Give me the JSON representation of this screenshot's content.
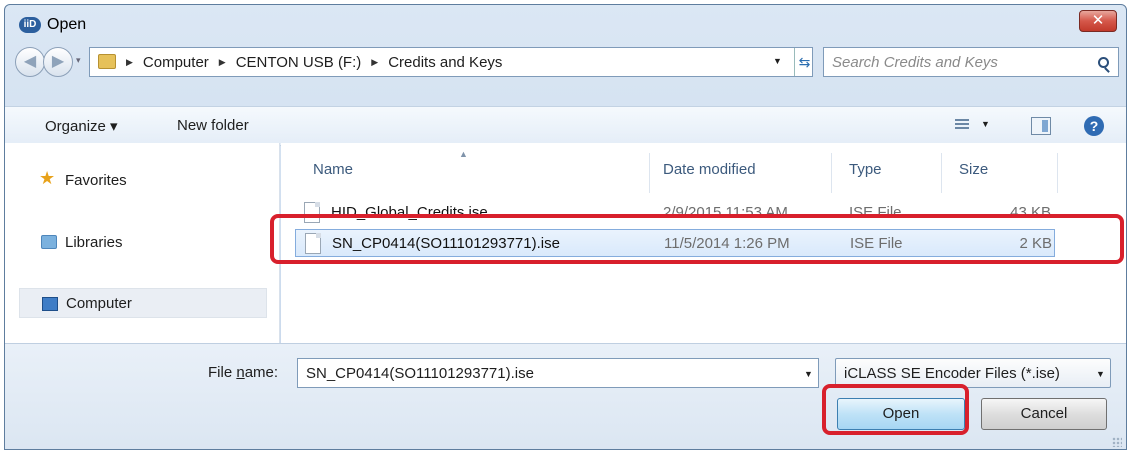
{
  "window": {
    "title": "Open",
    "app_icon": "hid-logo-icon",
    "app_icon_text": "iiD",
    "close_glyph": "✕"
  },
  "nav": {
    "back_glyph": "◀",
    "forward_glyph": "▶",
    "breadcrumbs": [
      "Computer",
      "CENTON USB (F:)",
      "Credits and Keys"
    ],
    "separator": "▶",
    "search_placeholder": "Search Credits and Keys"
  },
  "toolbar": {
    "organize_label": "Organize ▾",
    "new_folder_label": "New folder",
    "help_glyph": "?"
  },
  "sidebar": {
    "items": [
      {
        "label": "Favorites",
        "icon": "star-icon"
      },
      {
        "label": "Libraries",
        "icon": "libraries-icon"
      },
      {
        "label": "Computer",
        "icon": "computer-icon"
      }
    ]
  },
  "file_list": {
    "columns": [
      "Name",
      "Date modified",
      "Type",
      "Size"
    ],
    "rows": [
      {
        "name": "HID_Global_Credits.ise",
        "date": "2/9/2015 11:53 AM",
        "type": "ISE File",
        "size": "43 KB",
        "selected": false
      },
      {
        "name": "SN_CP0414(SO11101293771).ise",
        "date": "11/5/2014 1:26 PM",
        "type": "ISE File",
        "size": "2 KB",
        "selected": true
      }
    ]
  },
  "footer": {
    "file_name_label_pre": "File ",
    "file_name_label_u": "n",
    "file_name_label_post": "ame:",
    "file_name_value": "SN_CP0414(SO11101293771).ise",
    "filter_value": "iCLASS SE Encoder Files (*.ise)",
    "open_label": "Open",
    "cancel_label": "Cancel"
  },
  "colors": {
    "highlight": "#d8202c",
    "selection": "#d9e9fb",
    "accent": "#2f6bb3"
  }
}
